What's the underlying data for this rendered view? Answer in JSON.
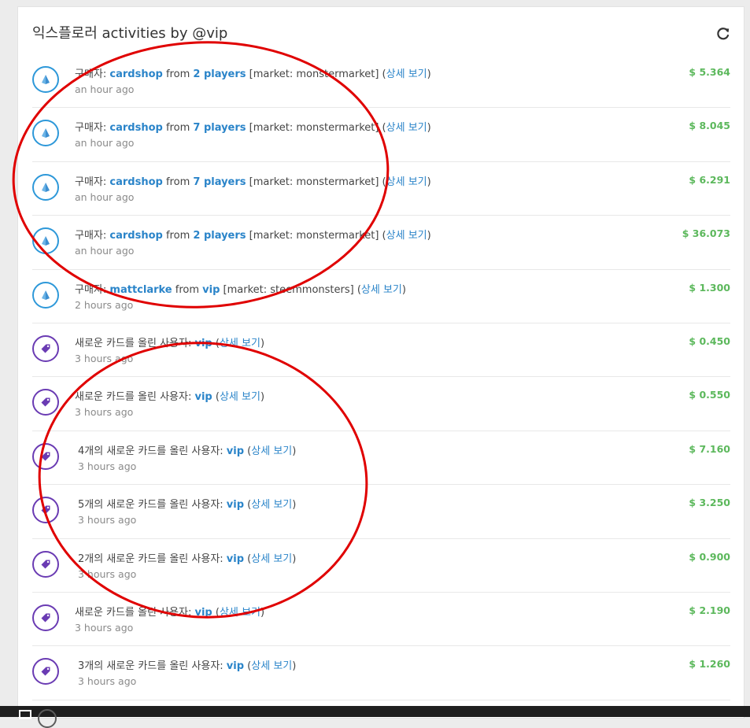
{
  "header": {
    "title": "익스플로러 activities by @vip"
  },
  "activities": [
    {
      "type": "buy",
      "buyer_prefix": "구매자: ",
      "buyer": "cardshop",
      "from": " from ",
      "seller": "2 players",
      "market": " [market: monstermarket] (",
      "detail": "상세 보기",
      "close": ")",
      "time": "an hour ago",
      "amount": "$ 5.364"
    },
    {
      "type": "buy",
      "buyer_prefix": "구매자: ",
      "buyer": "cardshop",
      "from": " from ",
      "seller": "7 players",
      "market": " [market: monstermarket] (",
      "detail": "상세 보기",
      "close": ")",
      "time": "an hour ago",
      "amount": "$ 8.045"
    },
    {
      "type": "buy",
      "buyer_prefix": "구매자: ",
      "buyer": "cardshop",
      "from": " from ",
      "seller": "7 players",
      "market": " [market: monstermarket] (",
      "detail": "상세 보기",
      "close": ")",
      "time": "an hour ago",
      "amount": "$ 6.291"
    },
    {
      "type": "buy",
      "buyer_prefix": "구매자: ",
      "buyer": "cardshop",
      "from": " from ",
      "seller": "2 players",
      "market": " [market: monstermarket] (",
      "detail": "상세 보기",
      "close": ")",
      "time": "an hour ago",
      "amount": "$ 36.073"
    },
    {
      "type": "buy",
      "buyer_prefix": "구매자: ",
      "buyer": "mattclarke",
      "from": " from ",
      "seller": "vip",
      "market": " [market: steemmonsters] (",
      "detail": "상세 보기",
      "close": ")",
      "time": "2 hours ago",
      "amount": "$ 1.300"
    },
    {
      "type": "list",
      "prefix": "새로운 카드를 올린 사용자: ",
      "user": "vip",
      "open": " (",
      "detail": "상세 보기",
      "close": ")",
      "time": "3 hours ago",
      "amount": "$ 0.450"
    },
    {
      "type": "list",
      "prefix": "새로운 카드를 올린 사용자: ",
      "user": "vip",
      "open": " (",
      "detail": "상세 보기",
      "close": ")",
      "time": "3 hours ago",
      "amount": "$ 0.550"
    },
    {
      "type": "list",
      "prefix": "4개의 새로운 카드를 올린 사용자: ",
      "user": "vip",
      "open": " (",
      "detail": "상세 보기",
      "close": ")",
      "time": "3 hours ago",
      "amount": "$ 7.160",
      "shift": true
    },
    {
      "type": "list",
      "prefix": "5개의 새로운 카드를 올린 사용자: ",
      "user": "vip",
      "open": " (",
      "detail": "상세 보기",
      "close": ")",
      "time": "3 hours ago",
      "amount": "$ 3.250",
      "shift": true
    },
    {
      "type": "list",
      "prefix": "2개의 새로운 카드를 올린 사용자: ",
      "user": "vip",
      "open": " (",
      "detail": "상세 보기",
      "close": ")",
      "time": "3 hours ago",
      "amount": "$ 0.900",
      "shift": true
    },
    {
      "type": "list",
      "prefix": "새로운 카드를 올린 사용자: ",
      "user": "vip",
      "open": " (",
      "detail": "상세 보기",
      "close": ")",
      "time": "3 hours ago",
      "amount": "$ 2.190"
    },
    {
      "type": "list",
      "prefix": "3개의 새로운 카드를 올린 사용자: ",
      "user": "vip",
      "open": " (",
      "detail": "상세 보기",
      "close": ")",
      "time": "3 hours ago",
      "amount": "$ 1.260",
      "shift": true
    }
  ],
  "colors": {
    "link": "#2a84c9",
    "amount": "#5cb85c",
    "buy_icon": "#2d98d9",
    "list_icon": "#6a3bb3",
    "annotation": "#e00000"
  },
  "icons": {
    "buy": "pyramid-icon",
    "list": "tag-icon",
    "refresh": "refresh-icon"
  }
}
